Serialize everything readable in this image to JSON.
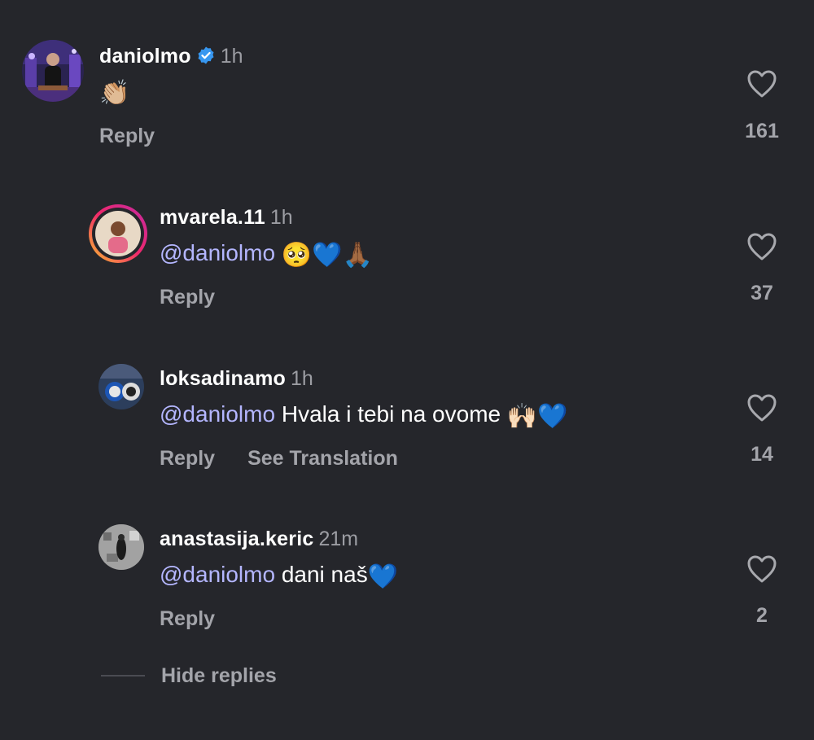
{
  "colors": {
    "background": "#25262b",
    "mention": "#b4b6ff",
    "secondary_text": "#a3a4aa",
    "verified_badge": "#3797f0"
  },
  "comments": [
    {
      "username": "daniolmo",
      "verified": true,
      "time": "1h",
      "mention": "",
      "text": "",
      "emoji": "👏🏼",
      "actions": [
        "Reply"
      ],
      "likes": "161"
    },
    {
      "username": "mvarela.11",
      "verified": false,
      "time": "1h",
      "mention": "@daniolmo",
      "text": "",
      "emoji": "🥺💙🙏🏾",
      "actions": [
        "Reply"
      ],
      "likes": "37"
    },
    {
      "username": "loksadinamo",
      "verified": false,
      "time": "1h",
      "mention": "@daniolmo",
      "text": "Hvala i tebi na ovome",
      "emoji": "🙌🏻💙",
      "actions": [
        "Reply",
        "See Translation"
      ],
      "likes": "14"
    },
    {
      "username": "anastasija.keric",
      "verified": false,
      "time": "21m",
      "mention": "@daniolmo",
      "text": "dani naš",
      "emoji": "💙",
      "actions": [
        "Reply"
      ],
      "likes": "2"
    }
  ],
  "hide_replies_label": "Hide replies",
  "icons": {
    "like": "heart-outline-icon",
    "verified": "verified-badge-icon"
  }
}
